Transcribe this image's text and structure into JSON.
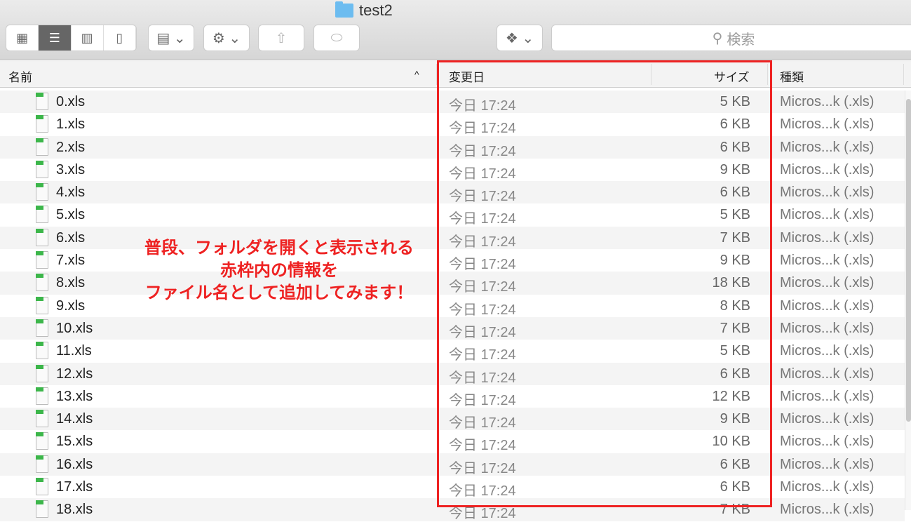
{
  "window": {
    "title": "test2"
  },
  "toolbar": {
    "search_placeholder": "検索"
  },
  "columns": {
    "name": "名前",
    "date": "変更日",
    "size": "サイズ",
    "kind": "種類"
  },
  "files": [
    {
      "name": "0.xls",
      "date": "今日 17:24",
      "size": "5 KB",
      "kind": "Micros...k (.xls)"
    },
    {
      "name": "1.xls",
      "date": "今日 17:24",
      "size": "6 KB",
      "kind": "Micros...k (.xls)"
    },
    {
      "name": "2.xls",
      "date": "今日 17:24",
      "size": "6 KB",
      "kind": "Micros...k (.xls)"
    },
    {
      "name": "3.xls",
      "date": "今日 17:24",
      "size": "9 KB",
      "kind": "Micros...k (.xls)"
    },
    {
      "name": "4.xls",
      "date": "今日 17:24",
      "size": "6 KB",
      "kind": "Micros...k (.xls)"
    },
    {
      "name": "5.xls",
      "date": "今日 17:24",
      "size": "5 KB",
      "kind": "Micros...k (.xls)"
    },
    {
      "name": "6.xls",
      "date": "今日 17:24",
      "size": "7 KB",
      "kind": "Micros...k (.xls)"
    },
    {
      "name": "7.xls",
      "date": "今日 17:24",
      "size": "9 KB",
      "kind": "Micros...k (.xls)"
    },
    {
      "name": "8.xls",
      "date": "今日 17:24",
      "size": "18 KB",
      "kind": "Micros...k (.xls)"
    },
    {
      "name": "9.xls",
      "date": "今日 17:24",
      "size": "8 KB",
      "kind": "Micros...k (.xls)"
    },
    {
      "name": "10.xls",
      "date": "今日 17:24",
      "size": "7 KB",
      "kind": "Micros...k (.xls)"
    },
    {
      "name": "11.xls",
      "date": "今日 17:24",
      "size": "5 KB",
      "kind": "Micros...k (.xls)"
    },
    {
      "name": "12.xls",
      "date": "今日 17:24",
      "size": "6 KB",
      "kind": "Micros...k (.xls)"
    },
    {
      "name": "13.xls",
      "date": "今日 17:24",
      "size": "12 KB",
      "kind": "Micros...k (.xls)"
    },
    {
      "name": "14.xls",
      "date": "今日 17:24",
      "size": "9 KB",
      "kind": "Micros...k (.xls)"
    },
    {
      "name": "15.xls",
      "date": "今日 17:24",
      "size": "10 KB",
      "kind": "Micros...k (.xls)"
    },
    {
      "name": "16.xls",
      "date": "今日 17:24",
      "size": "6 KB",
      "kind": "Micros...k (.xls)"
    },
    {
      "name": "17.xls",
      "date": "今日 17:24",
      "size": "6 KB",
      "kind": "Micros...k (.xls)"
    },
    {
      "name": "18.xls",
      "date": "今日 17:24",
      "size": "7 KB",
      "kind": "Micros...k (.xls)"
    }
  ],
  "annotation": {
    "lines": [
      "普段、フォルダを開くと表示される",
      "赤枠内の情報を",
      "ファイル名として追加してみます！"
    ],
    "color": "#ee2222"
  }
}
